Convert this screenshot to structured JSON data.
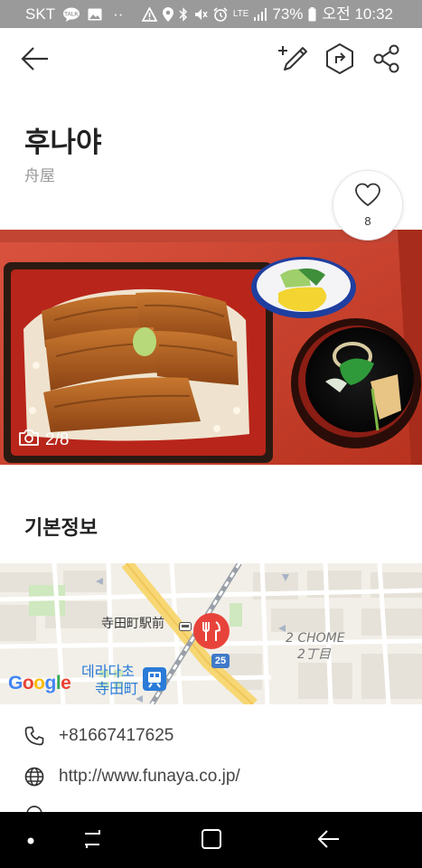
{
  "status_bar": {
    "carrier": "SKT",
    "battery": "73%",
    "time": "오전 10:32",
    "network": "LTE"
  },
  "app_bar": {
    "back_icon": "back-arrow-icon",
    "write_review_icon": "pencil-plus-icon",
    "directions_icon": "directions-icon",
    "share_icon": "share-icon"
  },
  "place": {
    "name": "후나야",
    "name_original": "舟屋",
    "like_count": "8"
  },
  "photo": {
    "counter": "2/8"
  },
  "basic_info": {
    "section_title": "기본정보",
    "map": {
      "station_label": "寺田町駅前",
      "area_label_en": "2 CHOME",
      "area_label_ja": "2丁目",
      "station_ko": "데라다초",
      "station_ja": "寺田町",
      "route_number": "25",
      "google": "Google"
    },
    "phone": "+81667417625",
    "website": "http://www.funaya.co.jp/"
  },
  "colors": {
    "accent_pin": "#e8433a",
    "map_blue": "#2a7bd8"
  }
}
